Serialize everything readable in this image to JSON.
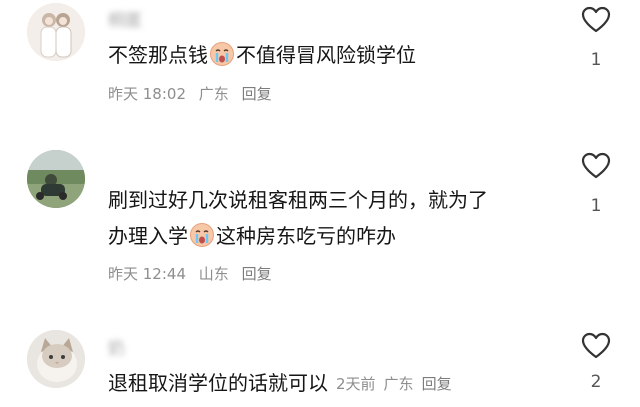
{
  "comments": [
    {
      "username": "桐匿",
      "text_part1": "不签那点钱",
      "text_part2": "不值得冒风险锁学位",
      "time": "昨天 18:02",
      "location": "广东",
      "reply": "回复",
      "likes": "1",
      "avatar": "illustrated-couple-avatar"
    },
    {
      "username": "",
      "line1": "刷到过好几次说租客租两三个月的，就为了",
      "line2_part1": "办理入学",
      "line2_part2": "这种房东吃亏的咋办",
      "time": "昨天 12:44",
      "location": "山东",
      "reply": "回复",
      "likes": "1",
      "avatar": "outdoor-photo-avatar"
    },
    {
      "username": "奶",
      "text": "退租取消学位的话就可以",
      "time": "2天前",
      "location": "广东",
      "reply": "回复",
      "likes": "2",
      "avatar": "cat-avatar"
    }
  ],
  "colors": {
    "text_primary": "#161616",
    "text_meta": "#8e8e8e",
    "icon_stroke": "#333333",
    "background": "#ffffff"
  },
  "icons": [
    "heart-outline-icon",
    "crying-emoji-icon"
  ]
}
